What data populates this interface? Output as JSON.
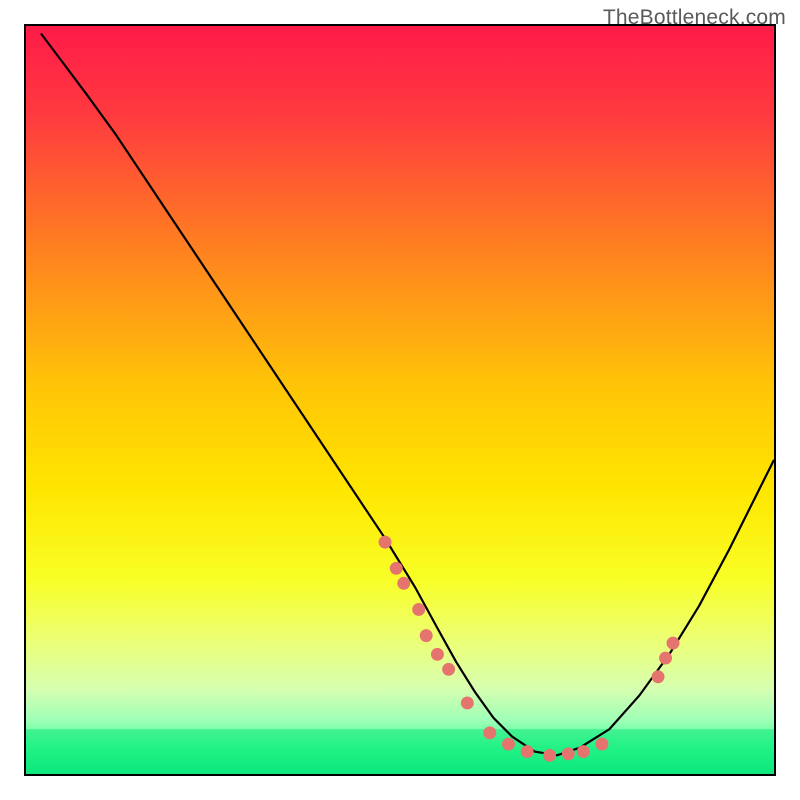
{
  "watermark": "TheBottleneck.com",
  "chart_data": {
    "type": "line",
    "title": "",
    "xlabel": "",
    "ylabel": "",
    "xlim": [
      0,
      100
    ],
    "ylim": [
      0,
      100
    ],
    "background": {
      "type": "vertical-gradient",
      "stops": [
        {
          "pos": 0.0,
          "color": "#ff1b49"
        },
        {
          "pos": 0.12,
          "color": "#ff3a3f"
        },
        {
          "pos": 0.28,
          "color": "#ff7a23"
        },
        {
          "pos": 0.48,
          "color": "#ffc407"
        },
        {
          "pos": 0.62,
          "color": "#ffe600"
        },
        {
          "pos": 0.74,
          "color": "#f8ff26"
        },
        {
          "pos": 0.82,
          "color": "#ecff74"
        },
        {
          "pos": 0.885,
          "color": "#d8ffb0"
        },
        {
          "pos": 0.93,
          "color": "#9bffb7"
        },
        {
          "pos": 0.965,
          "color": "#2fff8e"
        },
        {
          "pos": 1.0,
          "color": "#00e77a"
        }
      ]
    },
    "series": [
      {
        "name": "bottleneck-curve",
        "type": "line",
        "color": "#000000",
        "x": [
          2,
          5,
          8,
          12,
          16,
          20,
          24,
          28,
          32,
          36,
          40,
          44,
          48,
          52,
          55,
          57.5,
          60,
          62.5,
          65,
          68,
          71,
          74,
          78,
          82,
          86,
          90,
          94,
          98,
          100
        ],
        "y": [
          99,
          95,
          91,
          85.5,
          79.5,
          73.5,
          67.5,
          61.5,
          55.5,
          49.5,
          43.5,
          37.5,
          31.5,
          25,
          19.5,
          15,
          11,
          7.5,
          5,
          3,
          2.5,
          3.5,
          6,
          10.5,
          16,
          22.5,
          30,
          38,
          42
        ]
      },
      {
        "name": "sample-points",
        "type": "scatter",
        "color": "#e4746d",
        "x": [
          48,
          49.5,
          50.5,
          52.5,
          53.5,
          55,
          56.5,
          59,
          62,
          64.5,
          67,
          70,
          72.5,
          74.5,
          77,
          84.5,
          85.5,
          86.5
        ],
        "y": [
          31,
          27.5,
          25.5,
          22,
          18.5,
          16,
          14,
          9.5,
          5.5,
          4,
          3,
          2.5,
          2.7,
          3,
          4,
          13,
          15.5,
          17.5
        ]
      }
    ],
    "green_band": {
      "y_from": 0,
      "y_to": 6
    }
  }
}
